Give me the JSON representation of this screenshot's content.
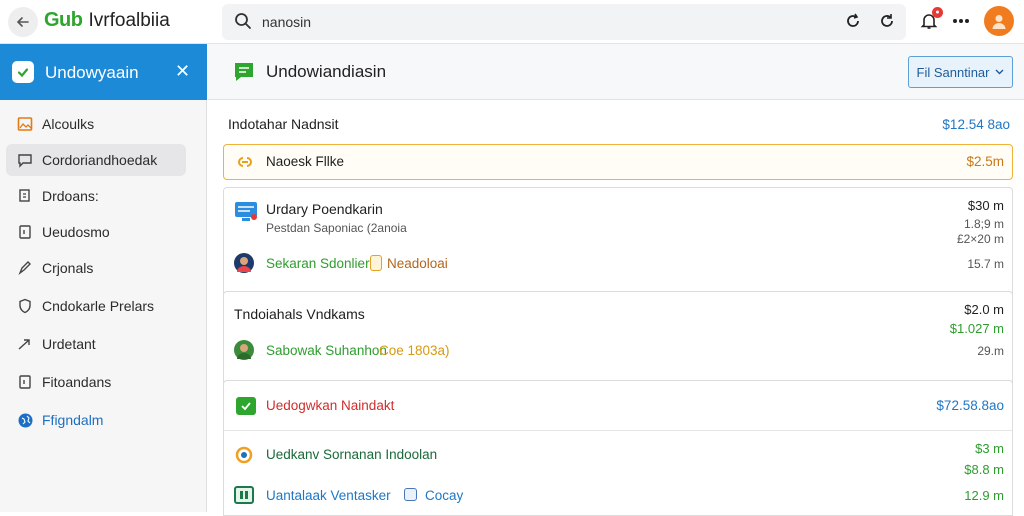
{
  "topbar": {
    "logo_mark": "Gub",
    "logo_text": "Ivrfoalbiia",
    "search_value": "nanosin"
  },
  "sidebar": {
    "title": "Undowyaain",
    "items": [
      {
        "label": "Alcoulks",
        "icon": "image-icon"
      },
      {
        "label": "Cordoriandhoedak",
        "icon": "chat-icon"
      },
      {
        "label": "Drdoans:",
        "icon": "copy-icon"
      },
      {
        "label": "Ueudosmo",
        "icon": "file-icon"
      },
      {
        "label": "Crjonals",
        "icon": "pen-icon"
      },
      {
        "label": "Cndokarle Prelars",
        "icon": "shield-icon"
      },
      {
        "label": "Urdetant",
        "icon": "arrow-icon"
      },
      {
        "label": "Fitoandans",
        "icon": "document-icon"
      },
      {
        "label": "Ffigndalm",
        "icon": "globe-icon"
      }
    ]
  },
  "main": {
    "title": "Undowiandiasin",
    "filter_label": "Fil Sanntinar",
    "header_row": {
      "label": "Indotahar Nadnsit",
      "value": "$12.54 8ao"
    },
    "gold_card": {
      "label": "Naoesk Fllke",
      "value": "$2.5m"
    },
    "card1": {
      "title": "Urdary Poendkarin",
      "subtitle": "Pestdan Saponiac (2anoia",
      "person": "Sekaran Sdonlier",
      "tag": "Neadoloai",
      "values": [
        "$30 m",
        "1.8;9 m",
        "£2×20 m",
        "15.7 m"
      ]
    },
    "card2": {
      "title": "Tndoiahals Vndkams",
      "person": "Sabowak Suhanhon",
      "tag": "Coe 1803a)",
      "values": [
        "$2.0 m",
        "$1.027 m",
        "29.m"
      ]
    },
    "card3": {
      "title": "Uedogwkan Naindakt",
      "value": "$72.58.8ao"
    },
    "list": [
      {
        "label": "Uedkanv Sornanan Indoolan",
        "values": [
          "$3 m",
          "$8.8 m"
        ]
      },
      {
        "label": "Uantalaak Ventasker",
        "tag": "Cocay",
        "value": "12.9 m"
      }
    ]
  }
}
